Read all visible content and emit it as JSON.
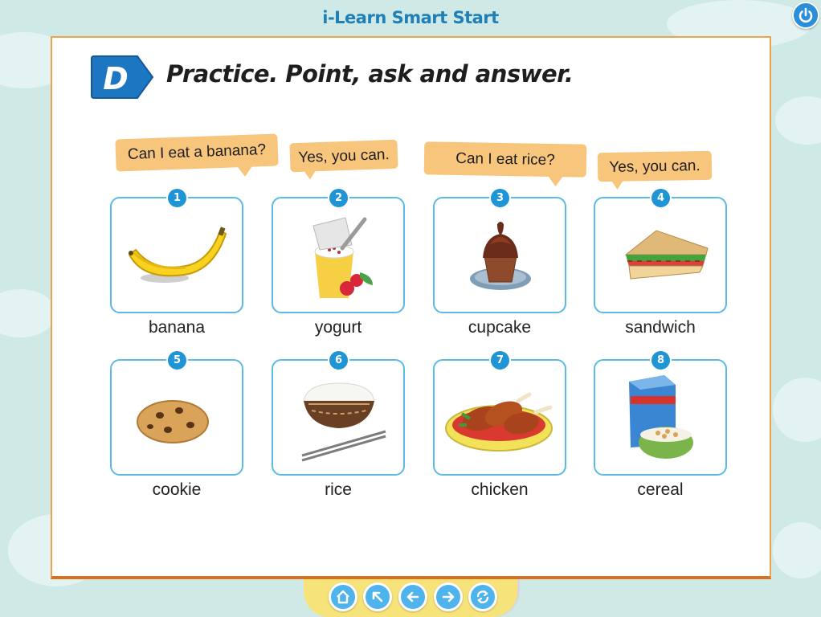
{
  "app": {
    "title": "i-Learn Smart Start"
  },
  "colors": {
    "background": "#cfe9e6",
    "frame": "#f0a24a",
    "accent_blue": "#1f95d6",
    "bubble": "#f8c57c",
    "title_blue": "#1f7fb6"
  },
  "lesson": {
    "badge_letter": "D",
    "heading": "Practice. Point, ask and answer."
  },
  "bubbles": [
    {
      "text": "Can I eat a banana?"
    },
    {
      "text": "Yes, you can."
    },
    {
      "text": "Can I eat rice?"
    },
    {
      "text": "Yes, you can."
    }
  ],
  "items": [
    {
      "number": "1",
      "word": "banana",
      "icon": "banana-icon"
    },
    {
      "number": "2",
      "word": "yogurt",
      "icon": "yogurt-icon"
    },
    {
      "number": "3",
      "word": "cupcake",
      "icon": "cupcake-icon"
    },
    {
      "number": "4",
      "word": "sandwich",
      "icon": "sandwich-icon"
    },
    {
      "number": "5",
      "word": "cookie",
      "icon": "cookie-icon"
    },
    {
      "number": "6",
      "word": "rice",
      "icon": "rice-bowl-icon"
    },
    {
      "number": "7",
      "word": "chicken",
      "icon": "roast-chicken-icon"
    },
    {
      "number": "8",
      "word": "cereal",
      "icon": "cereal-icon"
    }
  ],
  "nav": [
    {
      "icon": "home-icon"
    },
    {
      "icon": "arrow-up-left-icon"
    },
    {
      "icon": "arrow-left-icon"
    },
    {
      "icon": "arrow-right-icon"
    },
    {
      "icon": "refresh-icon"
    }
  ],
  "power": {
    "icon": "power-icon"
  }
}
